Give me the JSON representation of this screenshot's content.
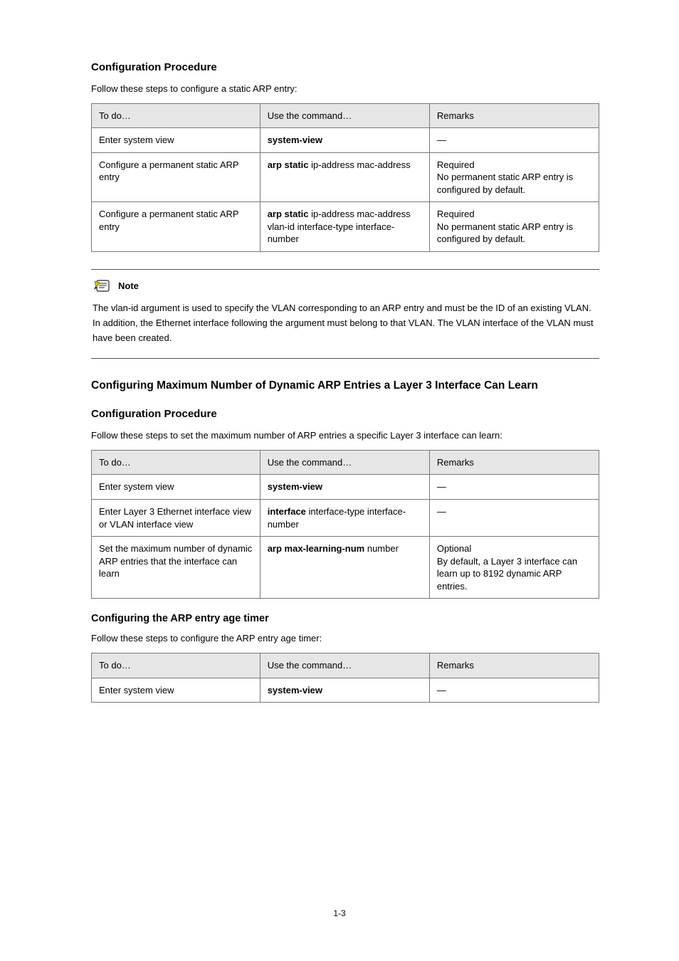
{
  "section_heading": "Configuration Procedure",
  "table1": {
    "title": "Follow these steps to configure a static ARP entry:",
    "headers": [
      "To do…",
      "Use the command…",
      "Remarks"
    ],
    "rows": [
      {
        "c0": "Enter system view",
        "c1_a": "system-view",
        "c1_b": "",
        "c2": "—"
      },
      {
        "c0": "Configure a permanent static ARP entry",
        "c1_a": "arp static ",
        "c1_b": "ip-address mac-address",
        "c2": "Required\nNo permanent static ARP entry is configured by default."
      },
      {
        "c0": "Configure a permanent static ARP entry",
        "c1_a": "arp static ",
        "c1_b": "ip-address mac-address vlan-id interface-type interface-number",
        "c2": "Required\nNo permanent static ARP entry is configured by default."
      }
    ]
  },
  "note": {
    "label": "Note",
    "text": "The vlan-id argument is used to specify the VLAN corresponding to an ARP entry and must be the ID of an existing VLAN. In addition, the Ethernet interface following the argument must belong to that VLAN. The VLAN interface of the VLAN must have been created."
  },
  "section2_heading": "Configuring Maximum Number of Dynamic ARP Entries a Layer 3 Interface Can Learn",
  "section2_sub": "Configuration Procedure",
  "section2_intro": "Follow these steps to set the maximum number of ARP entries a specific Layer 3 interface can learn:",
  "table2": {
    "headers": [
      "To do…",
      "Use the command…",
      "Remarks"
    ],
    "rows": [
      {
        "c0": "Enter system view",
        "c1_a": "system-view",
        "c1_b": "",
        "c2": "—"
      },
      {
        "c0": "Enter Layer 3 Ethernet interface view or VLAN interface view",
        "c1_a": "interface ",
        "c1_b": "interface-type interface-number",
        "c2": "—"
      },
      {
        "c0": "Set the maximum number of dynamic ARP entries that the interface can learn",
        "c1_a": "arp max-learning-num ",
        "c1_b": "number",
        "c2": "Optional\nBy default, a Layer 3 interface can learn up to 8192 dynamic ARP entries."
      }
    ]
  },
  "section3": {
    "heading": "Configuring the ARP entry age timer",
    "intro": "Follow these steps to configure the ARP entry age timer:",
    "headers": [
      "To do…",
      "Use the command…",
      "Remarks"
    ],
    "row": {
      "c0": "Enter system view",
      "c1_a": "system-view",
      "c1_b": "",
      "c2": "—"
    }
  },
  "page_number": "1-3"
}
